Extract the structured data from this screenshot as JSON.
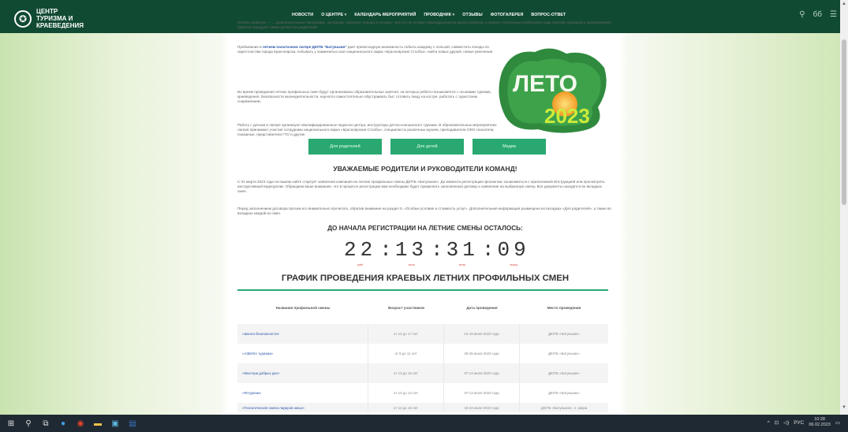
{
  "logo": {
    "text": "ЦЕНТР ТУРИЗМА И КРАЕВЕДЕНИЯ"
  },
  "nav": {
    "items": [
      {
        "label": "НОВОСТИ",
        "dropdown": false
      },
      {
        "label": "О ЦЕНТРЕ",
        "dropdown": true
      },
      {
        "label": "КАЛЕНДАРЬ МЕРОПРИЯТИЙ",
        "dropdown": false
      },
      {
        "label": "ПРОВОДНИК",
        "dropdown": true
      },
      {
        "label": "ОТЗЫВЫ",
        "dropdown": false
      },
      {
        "label": "ФОТОГАЛЕРЕЯ",
        "dropdown": false
      },
      {
        "label": "ВОПРОС-ОТВЕТ",
        "dropdown": false
      }
    ],
    "right": {
      "search": "search-icon",
      "vision": "бб",
      "menu": "menu-icon"
    }
  },
  "intro": {
    "top_partial": "Летние каникулы — ... развлекательные программы, экскурсии, тренинги, походы и сплавы - всё это не оставит равнодушным ни одного ребёнка, а знания, полученные ребёнком в ходе занятий туризмом и краеведением, приятно порадуют самих детей и их родителей.",
    "p1_pre": "Пребывание в ",
    "p1_bold": "летнем палаточном лагере ДЮТБ \"Батунькин\"",
    "p1_post": " дает превосходную возможность побыть каждому с пользой, совместить походы по окрестностям города Красноярска, побывать у знаменитых скал национального парка «Красноярские Столбы», найти новых друзей, новые увлечения.",
    "p2": "Во время проведения летних профильных смен будут организованы образовательные занятия, на которых ребята познакомятся с основами туризма, краеведения, безопасности жизнедеятельности, научатся самостоятельно обустраивать быт, готовить пищу на костре, работать с туристским снаряжением.",
    "p3": "Работу с детьми в лагере организуют квалифицированные педагоги центра, инструкторы детско-юношеского туризма. В образовательных мероприятиях лагеря принимают участие сотрудники национального парка «Красноярские Столбы», специалисты различных музеев, преподаватели СФО спасатели, пожарные, представители ГТО и другие."
  },
  "leto": {
    "word": "ЛЕТО",
    "year": "2023"
  },
  "buttons": [
    "Для родителей",
    "Для детей",
    "Медиа"
  ],
  "notice": {
    "title": "УВАЖАЕМЫЕ РОДИТЕЛИ И РУКОВОДИТЕЛИ КОМАНД!",
    "p1": "С 01 марта 2023 года на нашем сайте стартует заявочная кампания на летние профильные смены ДЮТБ «Батунькин». До момента регистрации просим вас ознакомиться с прилагаемой Инструкцией или просмотреть инструктивный видеоролик. Обращаем ваше внимание, что в процессе регистрации вам необходимо будет прикрепить заполненный договор и заявление на выбранную смену. Все документы находятся во вкладках смен.",
    "p2": "Перед заполнением договора просим его внимательно прочитать, обратив внимание на раздел 5. «Особые условия и стоимость услуг». Дополнительная информация размещена во вкладках «Для родителей», а также во вкладках каждой из смен."
  },
  "countdown": {
    "title": "ДО НАЧАЛА РЕГИСТРАЦИИ НА ЛЕТНИЕ СМЕНЫ ОСТАЛОСЬ:",
    "days": "22",
    "hours": "13",
    "minutes": "31",
    "seconds": "09",
    "labels": {
      "days": "дней",
      "hours": "часов",
      "minutes": "минут",
      "seconds": "секунд"
    }
  },
  "schedule": {
    "title": "ГРАФИК ПРОВЕДЕНИЯ КРАЕВЫХ ЛЕТНИХ ПРОФИЛЬНЫХ СМЕН",
    "headers": [
      "Название профильной смены",
      "Возраст участников",
      "Дата проведения",
      "Место проведения"
    ],
    "rows": [
      [
        "«Школа безопасности»",
        "от 13 до 17 лет",
        "14-19 июня 2023 года",
        "ДЮТБ «Батунькин»"
      ],
      [
        "«АЗБУКА туризма»",
        "от 9 до 11 лет",
        "20-25 июня 2023 года",
        "ДЮТБ «Батунькин»"
      ],
      [
        "«Мастера добрых дел»",
        "от 13 до 16 лет",
        "07-13 июля 2023 года",
        "ДЮТБ «Батунькин»"
      ],
      [
        "«Ретуризм»",
        "от 10 до 13 лет",
        "07-13 июля 2023 года",
        "ДЮТБ «Батунькин»"
      ],
      [
        "«Геологическая смена лидеров юных»",
        "от 12 до 16 лет",
        "16-22 июля 2023 года",
        "ДЮТБ «Батунькин», п. Шира"
      ]
    ]
  },
  "taskbar": {
    "lang": "РУС",
    "time": "10:28",
    "date": "06.02.2023"
  }
}
